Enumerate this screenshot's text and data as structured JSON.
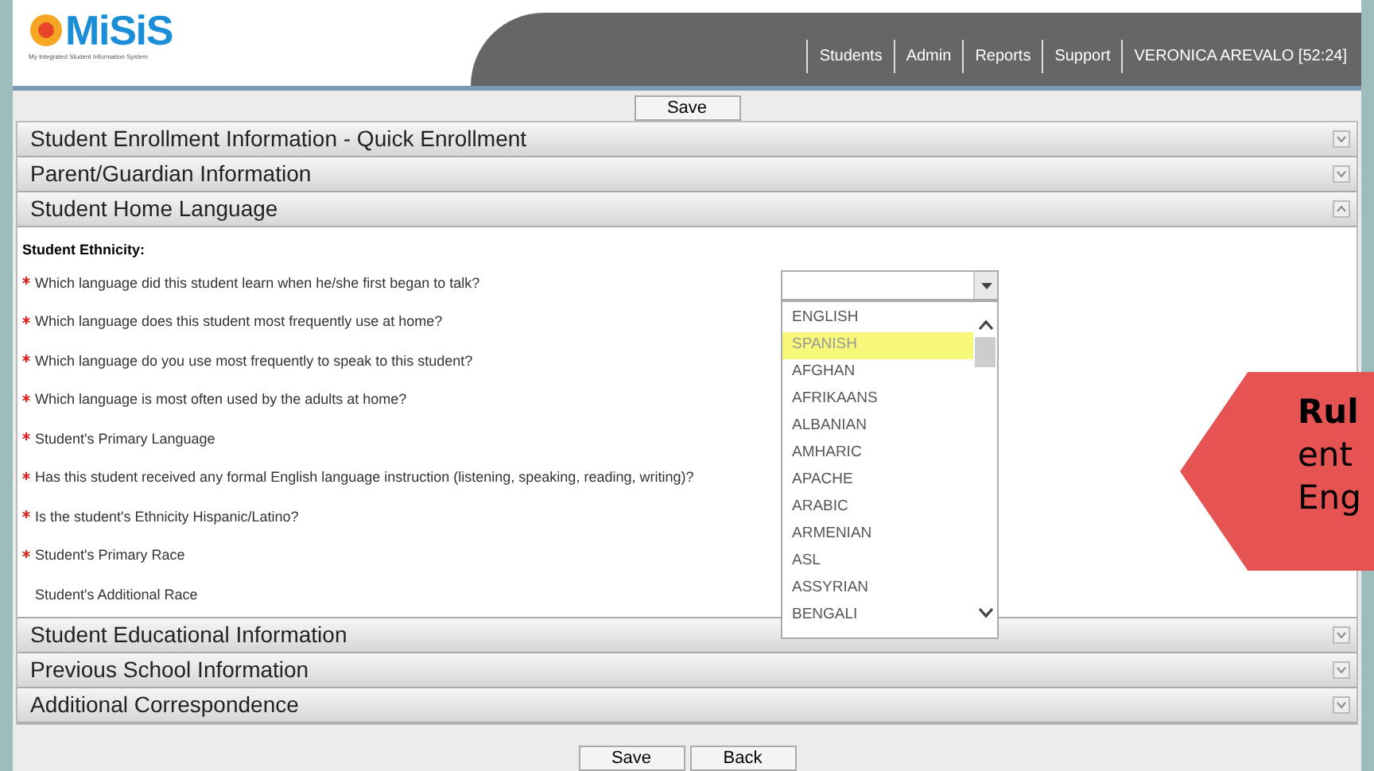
{
  "header": {
    "logo": {
      "title": "MiSiS",
      "subtitle": "My Integrated Student Information System"
    },
    "nav": [
      {
        "label": "Students"
      },
      {
        "label": "Admin"
      },
      {
        "label": "Reports"
      },
      {
        "label": "Support"
      },
      {
        "label": "VERONICA AREVALO [52:24]"
      }
    ]
  },
  "top_buttons": [
    "Save"
  ],
  "sections": [
    {
      "title": "Student Enrollment Information - Quick Enrollment",
      "expanded": false
    },
    {
      "title": "Parent/Guardian Information",
      "expanded": false
    },
    {
      "title": "Student Home Language",
      "expanded": true,
      "heading": "Student Ethnicity:",
      "fields": [
        {
          "label": "Which language did this student learn when he/she first began to talk?",
          "required": true
        },
        {
          "label": "Which language does this student most frequently use at home?",
          "required": true
        },
        {
          "label": "Which language do you use most frequently to speak to this student?",
          "required": true
        },
        {
          "label": "Which language is most often used by the adults at home?",
          "required": true
        },
        {
          "label": "Student's Primary Language",
          "required": true
        },
        {
          "label": "Has this student received any formal English language instruction (listening, speaking, reading, writing)?",
          "required": true
        },
        {
          "label": "Is the student's Ethnicity Hispanic/Latino?",
          "required": true
        },
        {
          "label": "Student's Primary Race",
          "required": true
        },
        {
          "label": "Student's Additional Race",
          "required": false
        }
      ]
    },
    {
      "title": "Student Educational Information",
      "expanded": false
    },
    {
      "title": "Previous School Information",
      "expanded": false
    },
    {
      "title": "Additional Correspondence",
      "expanded": false
    }
  ],
  "language_dropdown": {
    "options": [
      {
        "label": "ENGLISH",
        "highlighted": false
      },
      {
        "label": "SPANISH",
        "highlighted": true
      },
      {
        "label": "AFGHAN",
        "highlighted": false
      },
      {
        "label": "AFRIKAANS",
        "highlighted": false
      },
      {
        "label": "ALBANIAN",
        "highlighted": false
      },
      {
        "label": "AMHARIC",
        "highlighted": false
      },
      {
        "label": "APACHE",
        "highlighted": false
      },
      {
        "label": "ARABIC",
        "highlighted": false
      },
      {
        "label": "ARMENIAN",
        "highlighted": false
      },
      {
        "label": "ASL",
        "highlighted": false
      },
      {
        "label": "ASSYRIAN",
        "highlighted": false
      },
      {
        "label": "BENGALI",
        "highlighted": false
      }
    ]
  },
  "bottom_buttons": [
    "Save",
    "Back"
  ],
  "callout": {
    "lines": [
      {
        "text": "Rul",
        "bold": true
      },
      {
        "text": "ent",
        "bold": false
      },
      {
        "text": "Eng",
        "bold": false
      }
    ]
  }
}
